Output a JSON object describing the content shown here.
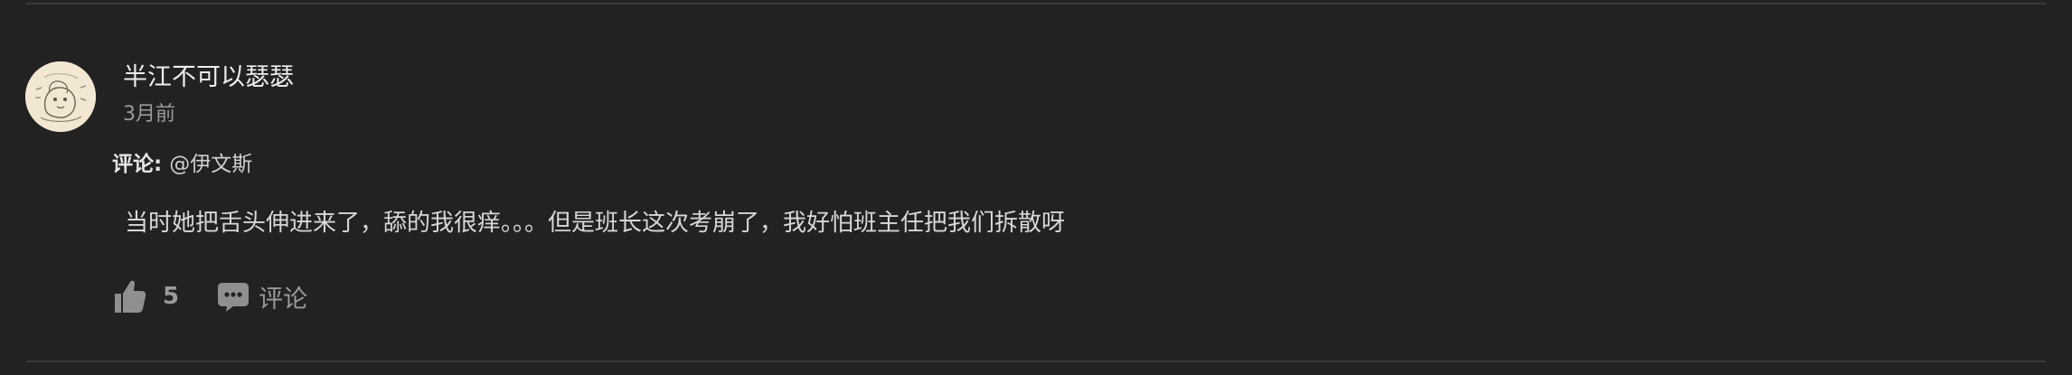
{
  "comment": {
    "username": "半江不可以瑟瑟",
    "timestamp": "3月前",
    "reply_label": "评论:",
    "reply_target": "@伊文斯",
    "content": "当时她把舌头伸进来了，舔的我很痒。。。但是班长这次考崩了，我好怕班主任把我们拆散呀",
    "likes": "5",
    "comment_action_label": "评论"
  },
  "icons": {
    "like": "thumbs-up-icon",
    "comment": "chat-bubble-icon"
  },
  "colors": {
    "background": "#222222",
    "divider": "#3a3a3a",
    "text_primary": "#eeeeee",
    "text_secondary": "#9b9b9b",
    "icon": "#8f8f8f"
  }
}
